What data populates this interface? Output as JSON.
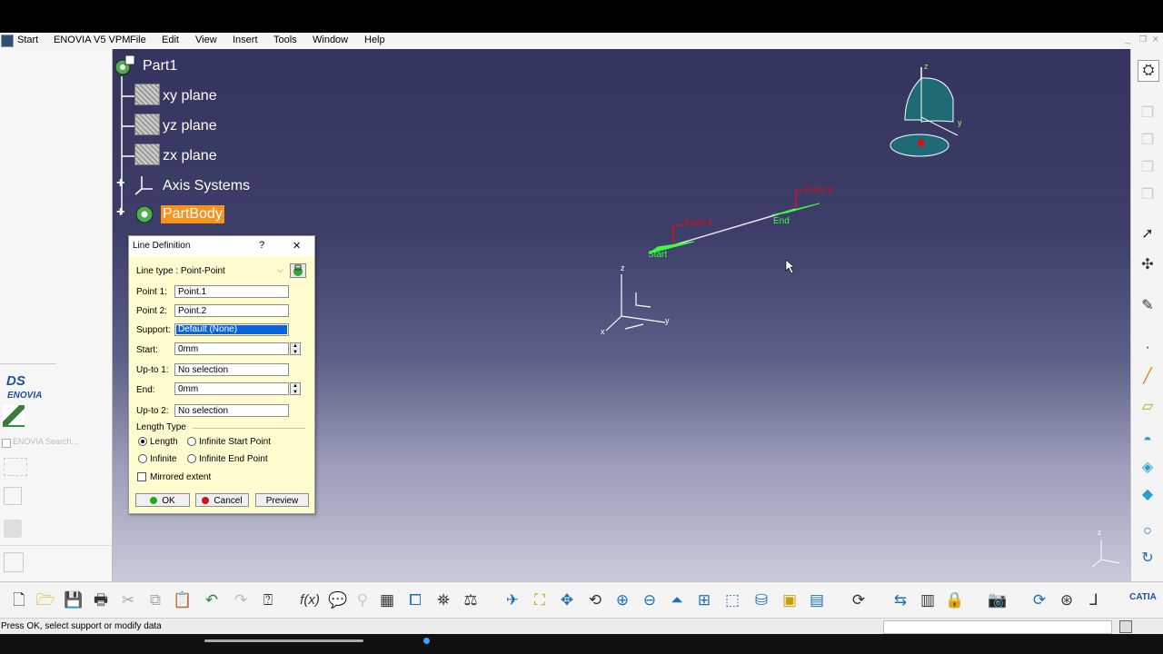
{
  "menubar": {
    "start": "Start",
    "app": "ENOVIA V5 VPM",
    "items": [
      "File",
      "Edit",
      "View",
      "Insert",
      "Tools",
      "Window",
      "Help"
    ]
  },
  "tree": {
    "root": "Part1",
    "items": [
      "xy plane",
      "yz plane",
      "zx plane",
      "Axis Systems",
      "PartBody"
    ]
  },
  "leftpanel": {
    "enovia_search": "ENOVIA Search..."
  },
  "dialog": {
    "title": "Line Definition",
    "help": "?",
    "close": "✕",
    "line_type_label": "Line type : Point-Point",
    "point1_label": "Point 1:",
    "point1_value": "Point.1",
    "point2_label": "Point 2:",
    "point2_value": "Point.2",
    "support_label": "Support:",
    "support_value": "Default (None)",
    "start_label": "Start:",
    "start_value": "0mm",
    "upto1_label": "Up-to 1:",
    "upto1_value": "No selection",
    "end_label": "End:",
    "end_value": "0mm",
    "upto2_label": "Up-to 2:",
    "upto2_value": "No selection",
    "length_type_label": "Length Type",
    "radio_length": "Length",
    "radio_infinite_start": "Infinite Start Point",
    "radio_infinite": "Infinite",
    "radio_infinite_end": "Infinite End Point",
    "mirrored_extent": "Mirrored extent",
    "ok": "OK",
    "cancel": "Cancel",
    "preview": "Preview"
  },
  "viewport": {
    "point1_label": "Point.1",
    "point2_label": "Point.2",
    "start_label": "Start",
    "end_label": "End",
    "axis_x": "x",
    "axis_y": "y",
    "axis_z": "z"
  },
  "statusbar": {
    "message": "Press OK, select support or modify data"
  },
  "colors": {
    "selection": "#0a64d8",
    "highlight_orange": "#f7941d",
    "preview_green": "#3dff3d",
    "point_red": "#d4101a"
  }
}
